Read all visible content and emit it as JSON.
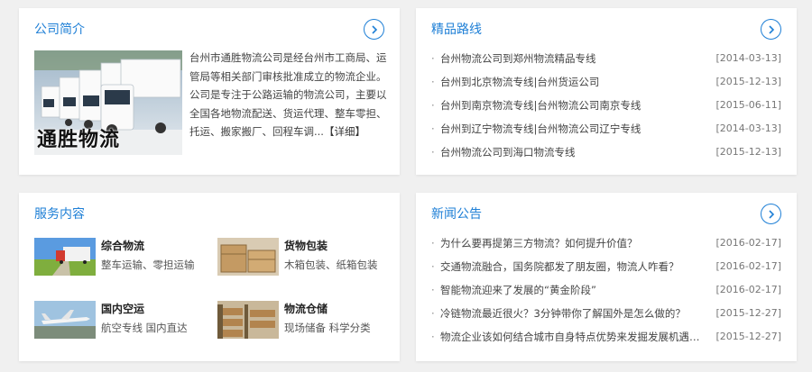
{
  "about": {
    "title": "公司简介",
    "logo_text": "通胜物流",
    "text": "台州市通胜物流公司是经台州市工商局、运管局等相关部门审核批准成立的物流企业。公司是专注于公路运输的物流公司，主要以全国各地物流配送、货运代理、整车零担、托运、搬家搬厂、回程车调...",
    "detail_link": "【详细】"
  },
  "routes": {
    "title": "精品路线",
    "items": [
      {
        "title": "台州物流公司到郑州物流精品专线",
        "date": "[2014-03-13]"
      },
      {
        "title": "台州到北京物流专线|台州货运公司",
        "date": "[2015-12-13]"
      },
      {
        "title": "台州到南京物流专线|台州物流公司南京专线",
        "date": "[2015-06-11]"
      },
      {
        "title": "台州到辽宁物流专线|台州物流公司辽宁专线",
        "date": "[2014-03-13]"
      },
      {
        "title": "台州物流公司到海口物流专线",
        "date": "[2015-12-13]"
      }
    ]
  },
  "services": {
    "title": "服务内容",
    "items": [
      {
        "name": "综合物流",
        "desc": "整车运输、零担运输"
      },
      {
        "name": "货物包装",
        "desc": "木箱包装、纸箱包装"
      },
      {
        "name": "国内空运",
        "desc": "航空专线 国内直达"
      },
      {
        "name": "物流仓储",
        "desc": "现场储备 科学分类"
      }
    ]
  },
  "news": {
    "title": "新闻公告",
    "items": [
      {
        "title": "为什么要再提第三方物流？如何提升价值？",
        "date": "[2016-02-17]"
      },
      {
        "title": "交通物流融合，国务院都发了朋友圈，物流人咋看？",
        "date": "[2016-02-17]"
      },
      {
        "title": "智能物流迎来了发展的“黄金阶段”",
        "date": "[2016-02-17]"
      },
      {
        "title": "冷链物流最近很火？3分钟带你了解国外是怎么做的？",
        "date": "[2015-12-27]"
      },
      {
        "title": "物流企业该如何结合城市自身特点优势来发掘发展机遇呢？",
        "date": "[2015-12-27]"
      }
    ]
  },
  "colors": {
    "accent": "#1e7fd6",
    "background": "#f0f0f0"
  }
}
